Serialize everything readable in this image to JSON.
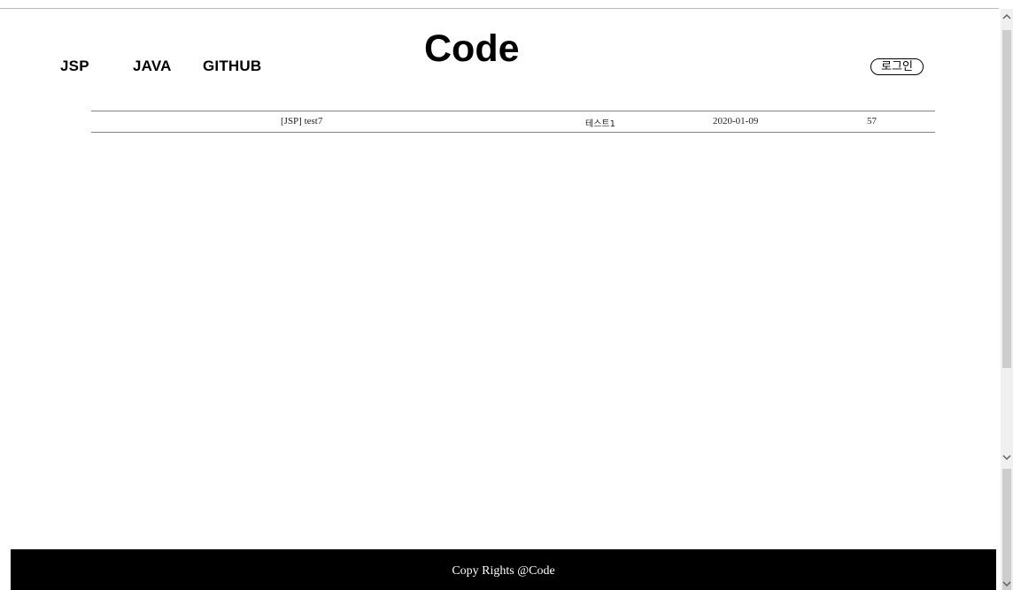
{
  "header": {
    "nav": [
      {
        "label": "JSP"
      },
      {
        "label": "JAVA"
      },
      {
        "label": "GITHUB"
      }
    ],
    "logo": "Code",
    "login_label": "로그인"
  },
  "board": {
    "rows": [
      {
        "title": "[JSP] test7",
        "author": "테스트1",
        "date": "2020-01-09",
        "views": "57"
      }
    ]
  },
  "footer": {
    "text": "Copy Rights @Code"
  },
  "icons": {
    "scroll_up": "chevron-up-icon",
    "scroll_down": "chevron-down-icon"
  },
  "colors": {
    "footer_bg": "#000000",
    "footer_text": "#ffffff",
    "rule": "#808080"
  }
}
